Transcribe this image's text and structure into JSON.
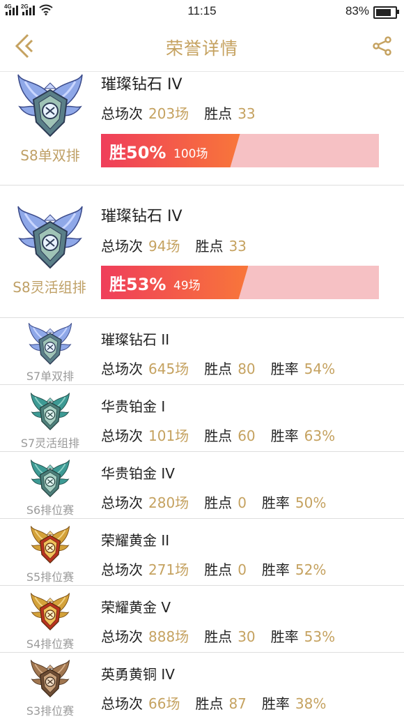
{
  "status_bar": {
    "time": "11:15",
    "battery": "83%",
    "net1": "4G",
    "net2": "2G"
  },
  "nav": {
    "title": "荣誉详情"
  },
  "seasons": [
    {
      "season": "S8单双排",
      "rank": "璀璨钻石 IV",
      "games_label": "总场次",
      "games": "203场",
      "points_label": "胜点",
      "points": "33",
      "win_prefix": "胜",
      "win_rate": "50%",
      "wins": "100场",
      "win_fraction": 0.5,
      "tier": "diamond"
    },
    {
      "season": "S8灵活组排",
      "rank": "璀璨钻石 IV",
      "games_label": "总场次",
      "games": "94场",
      "points_label": "胜点",
      "points": "33",
      "win_prefix": "胜",
      "win_rate": "53%",
      "wins": "49场",
      "win_fraction": 0.53,
      "tier": "diamond"
    },
    {
      "season": "S7单双排",
      "rank": "璀璨钻石 II",
      "games_label": "总场次",
      "games": "645场",
      "points_label": "胜点",
      "points": "80",
      "rate_label": "胜率",
      "win_rate": "54%",
      "tier": "diamond"
    },
    {
      "season": "S7灵活组排",
      "rank": "华贵铂金 I",
      "games_label": "总场次",
      "games": "101场",
      "points_label": "胜点",
      "points": "60",
      "rate_label": "胜率",
      "win_rate": "63%",
      "tier": "platinum"
    },
    {
      "season": "S6排位赛",
      "rank": "华贵铂金 IV",
      "games_label": "总场次",
      "games": "280场",
      "points_label": "胜点",
      "points": "0",
      "rate_label": "胜率",
      "win_rate": "50%",
      "tier": "platinum"
    },
    {
      "season": "S5排位赛",
      "rank": "荣耀黄金 II",
      "games_label": "总场次",
      "games": "271场",
      "points_label": "胜点",
      "points": "0",
      "rate_label": "胜率",
      "win_rate": "52%",
      "tier": "gold"
    },
    {
      "season": "S4排位赛",
      "rank": "荣耀黄金 V",
      "games_label": "总场次",
      "games": "888场",
      "points_label": "胜点",
      "points": "30",
      "rate_label": "胜率",
      "win_rate": "53%",
      "tier": "gold"
    },
    {
      "season": "S3排位赛",
      "rank": "英勇黄铜 IV",
      "games_label": "总场次",
      "games": "66场",
      "points_label": "胜点",
      "points": "87",
      "rate_label": "胜率",
      "win_rate": "38%",
      "tier": "bronze"
    }
  ],
  "colors": {
    "accent": "#c5a260",
    "bar_bg": "#f6c1c4",
    "bar_fill_start": "#ef3e5a",
    "bar_fill_end": "#f8763a"
  },
  "icons": {
    "back": "chevron-left-icon",
    "share": "share-icon",
    "diamond": "diamond-tier-icon",
    "platinum": "platinum-tier-icon",
    "gold": "gold-tier-icon",
    "bronze": "bronze-tier-icon"
  }
}
